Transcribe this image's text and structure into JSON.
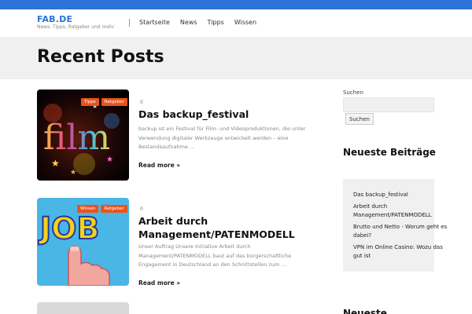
{
  "site": {
    "title": "FAB.DE",
    "tagline": "News, Tipps, Ratgeber und mehr",
    "accent_color": "#2b73d6",
    "tag_color": "#e8541c"
  },
  "nav": {
    "items": [
      {
        "label": "Startseite"
      },
      {
        "label": "News"
      },
      {
        "label": "Tipps"
      },
      {
        "label": "Wissen"
      }
    ]
  },
  "page": {
    "title": "Recent Posts"
  },
  "posts": [
    {
      "tags": [
        "Tipps",
        "Ratgeber"
      ],
      "comments": "0",
      "title": "Das backup_festival",
      "excerpt": "backup ist ein Festival für Film- und Videoproduktionen, die unter Verwendung digitaler Werkzeuge entwickelt werden – eine Bestandsaufnahme …",
      "read_more": "Read more »",
      "image_text": "film"
    },
    {
      "tags": [
        "Wissen",
        "Ratgeber"
      ],
      "comments": "0",
      "title": "Arbeit durch Management/PATENMODELL",
      "excerpt": "Unser Auftrag Unsere Initiative Arbeit durch Management/PATENMODELL baut auf das bürgerschaftliche Engagement in Deutschland an den Schnittstellen zum …",
      "read_more": "Read more »",
      "image_text": "JOB"
    }
  ],
  "sidebar": {
    "search_label": "Suchen",
    "search_button": "Suchen",
    "search_value": "",
    "recent_heading": "Neueste Beiträge",
    "recent_items": [
      {
        "label": "Das backup_festival"
      },
      {
        "label": "Arbeit durch Management/PATENMODELL"
      },
      {
        "label": "Brutto und Netto - Worum geht es dabei?"
      },
      {
        "label": "VPN im Online Casino: Wozu das gut ist"
      }
    ],
    "second_heading": "Neueste"
  }
}
